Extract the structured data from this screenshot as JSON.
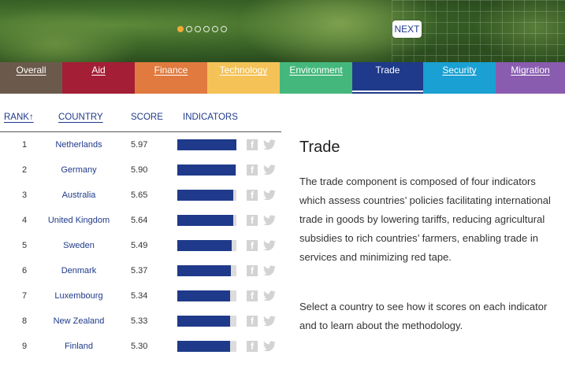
{
  "hero": {
    "slides": 6,
    "active_slide": 1,
    "next_label": "NEXT"
  },
  "tabs": [
    {
      "label": "Overall",
      "color": "#6b5a4b"
    },
    {
      "label": "Aid",
      "color": "#a41e35"
    },
    {
      "label": "Finance",
      "color": "#e07a3f"
    },
    {
      "label": "Technology",
      "color": "#f5c257"
    },
    {
      "label": "Environment",
      "color": "#44b87c"
    },
    {
      "label": "Trade",
      "color": "#1f3a8a",
      "active": true
    },
    {
      "label": "Security",
      "color": "#1aa0d2"
    },
    {
      "label": "Migration",
      "color": "#8a5cb0"
    }
  ],
  "table": {
    "headers": {
      "rank": "RANK",
      "rank_sort_icon": "arrow-up-icon",
      "country": "COUNTRY",
      "score": "SCORE",
      "indicators": "INDICATORS"
    },
    "bar_color": "#1f3a8a",
    "rows": [
      {
        "rank": "1",
        "country": "Netherlands",
        "score": "5.97",
        "indicator_fraction": 1.0
      },
      {
        "rank": "2",
        "country": "Germany",
        "score": "5.90",
        "indicator_fraction": 0.99
      },
      {
        "rank": "3",
        "country": "Australia",
        "score": "5.65",
        "indicator_fraction": 0.95
      },
      {
        "rank": "4",
        "country": "United Kingdom",
        "score": "5.64",
        "indicator_fraction": 0.94
      },
      {
        "rank": "5",
        "country": "Sweden",
        "score": "5.49",
        "indicator_fraction": 0.92
      },
      {
        "rank": "6",
        "country": "Denmark",
        "score": "5.37",
        "indicator_fraction": 0.9
      },
      {
        "rank": "7",
        "country": "Luxembourg",
        "score": "5.34",
        "indicator_fraction": 0.89
      },
      {
        "rank": "8",
        "country": "New Zealand",
        "score": "5.33",
        "indicator_fraction": 0.89
      },
      {
        "rank": "9",
        "country": "Finland",
        "score": "5.30",
        "indicator_fraction": 0.89
      }
    ]
  },
  "panel": {
    "title": "Trade",
    "paragraph1": "The trade component is composed of four indicators which assess countries’ policies facilitating international trade in goods by lowering tariffs, reducing agricultural subsidies to rich countries’ farmers, enabling trade in services and minimizing red tape.",
    "paragraph2": "Select a country to see how it scores on each indicator and to learn about the methodology."
  }
}
